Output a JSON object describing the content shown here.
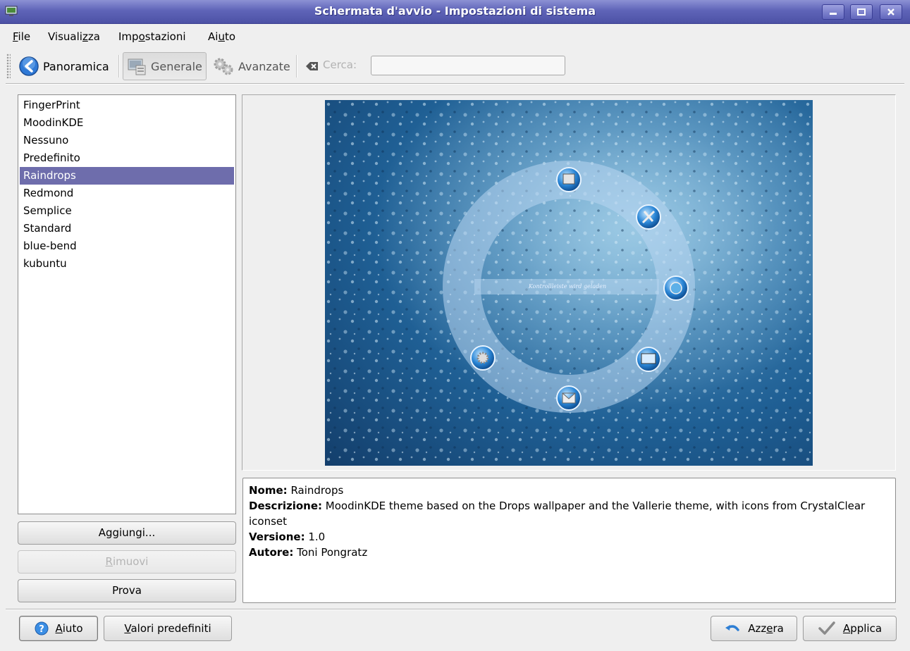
{
  "window": {
    "title": "Schermata d'avvio - Impostazioni di sistema"
  },
  "menu": {
    "file": [
      "",
      "F",
      "ile"
    ],
    "visualizza": [
      "Visuali",
      "z",
      "za"
    ],
    "impostazioni": [
      "Imp",
      "o",
      "stazioni"
    ],
    "aiuto": [
      "Ai",
      "u",
      "to"
    ]
  },
  "toolbar": {
    "panoramica": "Panoramica",
    "generale": "Generale",
    "avanzate": "Avanzate",
    "cerca_label": "Cerca:",
    "search_value": ""
  },
  "themes": {
    "items": [
      "FingerPrint",
      "MoodinKDE",
      "Nessuno",
      "Predefinito",
      "Raindrops",
      "Redmond",
      "Semplice",
      "Standard",
      "blue-bend",
      "kubuntu"
    ],
    "selected": "Raindrops"
  },
  "buttons": {
    "aggiungi": "Aggiungi...",
    "rimuovi": [
      "",
      "R",
      "imuovi"
    ],
    "prova": "Prova"
  },
  "preview": {
    "splash_text": "Kontrollleiste wird geladen"
  },
  "info": {
    "nome_label": "Nome:",
    "nome": "Raindrops",
    "descrizione_label": "Descrizione:",
    "descrizione": "MoodinKDE theme based on the Drops wallpaper and the Vallerie theme, with icons from CrystalClear iconset",
    "versione_label": "Versione:",
    "versione": "1.0",
    "autore_label": "Autore:",
    "autore": "Toni Pongratz"
  },
  "bottom": {
    "aiuto": [
      "",
      "A",
      "iuto"
    ],
    "valori_predefiniti": [
      "",
      "V",
      "alori predefiniti"
    ],
    "azzera": [
      "Azz",
      "e",
      "ra"
    ],
    "applica": [
      "",
      "A",
      "pplica"
    ]
  },
  "colors": {
    "titlebar": "#5f64b8",
    "selection": "#6e6dac"
  }
}
